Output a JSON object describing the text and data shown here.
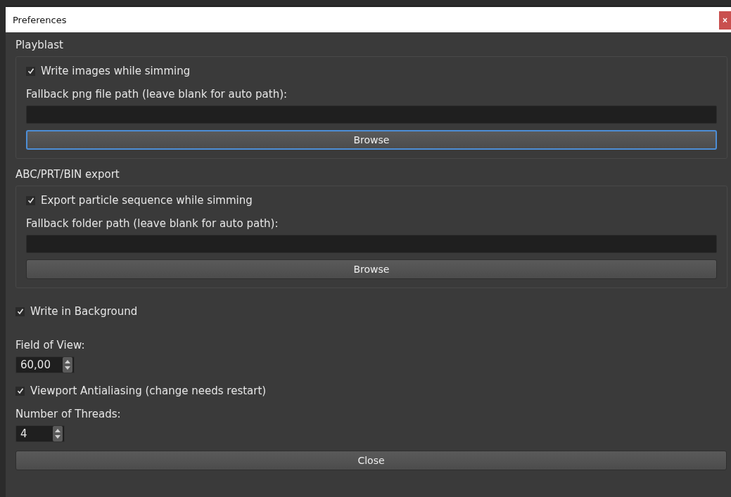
{
  "window": {
    "title": "Preferences",
    "close": "×"
  },
  "groups": [
    {
      "title": "Playblast",
      "checkbox": {
        "label": "Write images while simming",
        "checked": true
      },
      "path_label": "Fallback png file path (leave blank for auto path):",
      "button": {
        "label": "Browse",
        "focused": true
      }
    },
    {
      "title": "ABC/PRT/BIN export",
      "checkbox": {
        "label": "Export particle sequence while simming",
        "checked": true
      },
      "path_label": "Fallback folder path (leave blank for auto path):",
      "button": {
        "label": "Browse",
        "focused": false
      }
    }
  ],
  "write_in_background": {
    "label": "Write in Background",
    "checked": true
  },
  "field_of_view": {
    "label": "Field of View:",
    "value": "60,00"
  },
  "viewport_antialiasing": {
    "label": "Viewport Antialiasing (change needs restart)",
    "checked": true
  },
  "threads": {
    "label": "Number of Threads:",
    "value": "4"
  },
  "close_button": "Close"
}
